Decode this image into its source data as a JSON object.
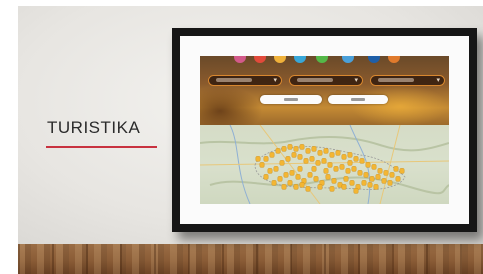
{
  "slide": {
    "title": "TURISTIKA",
    "accent_color": "#c8323f"
  },
  "screen": {
    "category_dot_colors": [
      "#d35a8a",
      "#e24a3b",
      "#f0b23a",
      "#38a7d8",
      "#54b848",
      "#4aa0d9",
      "#1f5fa8",
      "#e07a2c"
    ],
    "filters": [
      {
        "icon": "chevron-down-icon"
      },
      {
        "icon": "chevron-down-icon"
      },
      {
        "icon": "chevron-down-icon"
      }
    ],
    "buttons": [
      {},
      {}
    ],
    "map": {
      "marker_color": "#f3b634"
    }
  }
}
